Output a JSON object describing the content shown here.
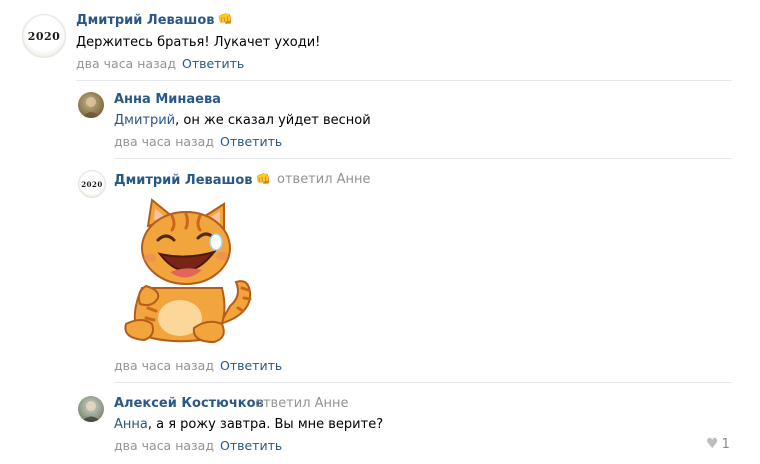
{
  "comments": [
    {
      "author": "Дмитрий Левашов",
      "author_badge": "fist-emoji",
      "avatar_text": "2020",
      "text": "Держитесь братья! Лукачет уходи!",
      "time": "два часа назад",
      "reply_label": "Ответить"
    },
    {
      "author": "Анна Минаева",
      "mention": "Дмитрий",
      "text": ", он же сказал уйдет весной",
      "time": "два часа назад",
      "reply_label": "Ответить"
    },
    {
      "author": "Дмитрий Левашов",
      "author_badge": "fist-emoji",
      "avatar_text": "2020",
      "replied_to": "ответил Анне",
      "sticker": "laughing-cat-sticker",
      "time": "два часа назад",
      "reply_label": "Ответить"
    },
    {
      "author": "Алексей Костючков",
      "replied_to": "ответил Анне",
      "mention": "Анна",
      "text": ", а я рожу завтра. Вы мне верите?",
      "time": "два часа назад",
      "reply_label": "Ответить",
      "likes": "1"
    }
  ],
  "colors": {
    "link": "#2a5885",
    "meta": "#939393",
    "separator": "#e7e8ec",
    "cat_fur": "#f2a53c"
  }
}
